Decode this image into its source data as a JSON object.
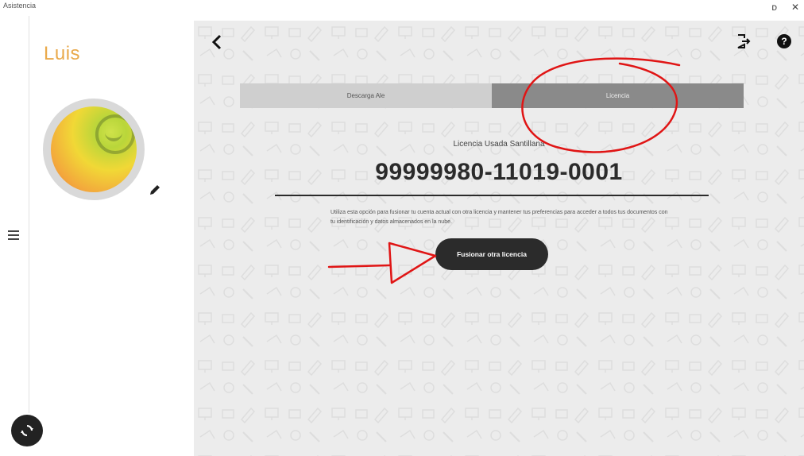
{
  "window": {
    "title": "Asistencia",
    "minimize_glyph": "ᴅ",
    "close_glyph": "✕"
  },
  "sidebar": {
    "user_name": "Luis",
    "avatar_icon": "user-avatar",
    "edit_icon": "pencil-icon",
    "menu_icon": "hamburger-icon",
    "sync_icon": "sync-icon"
  },
  "header": {
    "back_icon": "chevron-left-icon",
    "logout_icon": "logout-icon",
    "help_icon": "help-icon",
    "help_glyph": "?"
  },
  "tabs": [
    {
      "label": "Descarga Ale",
      "active": false
    },
    {
      "label": "Licencia",
      "active": true
    }
  ],
  "license": {
    "owner": "Licencia Usada Santillana",
    "number": "99999980-11019-0001",
    "description": "Utiliza esta opción para fusionar tu cuenta actual con otra licencia y mantener tus preferencias para acceder a todos tus documentos con tu identificación y datos almacenados en la nube."
  },
  "actions": {
    "merge_label": "Fusionar otra licencia"
  },
  "colors": {
    "accent_name": "#e9a94a",
    "annotation_red": "#e01515",
    "dark": "#2b2b2b",
    "panel_bg": "#ececec"
  }
}
